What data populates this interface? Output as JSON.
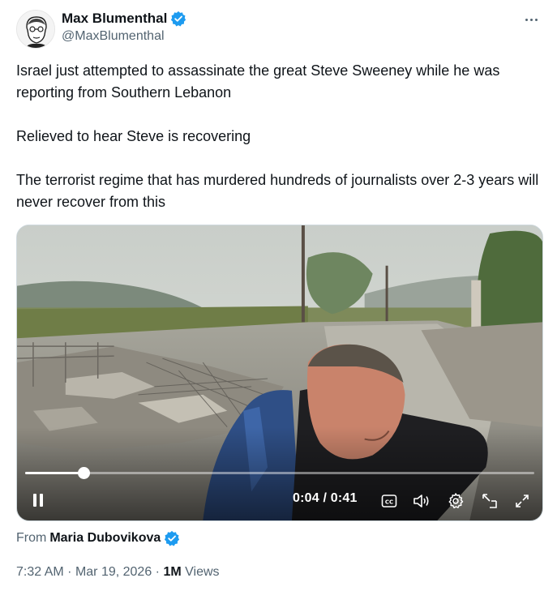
{
  "author": {
    "display_name": "Max Blumenthal",
    "handle": "@MaxBlumenthal",
    "verified": true
  },
  "tweet": {
    "paragraphs": [
      "Israel just attempted to assassinate the great Steve Sweeney while he was reporting from Southern Lebanon",
      "Relieved to hear Steve is recovering",
      "The terrorist regime that has murdered hundreds of journalists over 2-3 years will never recover from this"
    ]
  },
  "video": {
    "time_display": "0:04 / 0:41",
    "progress": 0.115,
    "controls": [
      "pause-icon",
      "captions-icon",
      "volume-icon",
      "settings-icon",
      "pip-icon",
      "fullscreen-icon"
    ]
  },
  "source": {
    "prefix": "From",
    "name": "Maria Dubovikova",
    "verified": true
  },
  "meta": {
    "time": "7:32 AM",
    "separator": "·",
    "date": "Mar 19, 2026",
    "views_count": "1M",
    "views_label": "Views"
  },
  "colors": {
    "verified_blue": "#1d9bf0",
    "text_primary": "#0f1419",
    "text_secondary": "#536471",
    "border": "#cfd9de"
  }
}
